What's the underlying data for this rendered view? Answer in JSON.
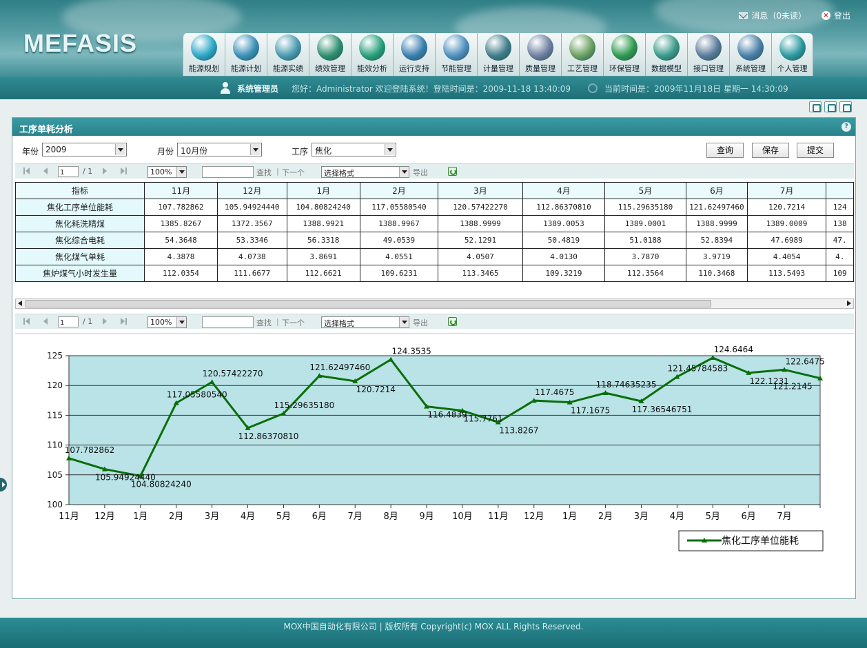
{
  "app": {
    "logo": "MEFASIS"
  },
  "top_links": {
    "messages": "消息（0未读）",
    "logout": "登出"
  },
  "nav": [
    {
      "label": "能源规划",
      "icon": "energy-planning-icon",
      "color": "#2aa6c8"
    },
    {
      "label": "能源计划",
      "icon": "energy-plan-icon",
      "color": "#3b8fb8"
    },
    {
      "label": "能源实绩",
      "icon": "energy-actual-icon",
      "color": "#4a9ab0"
    },
    {
      "label": "绩效管理",
      "icon": "performance-icon",
      "color": "#2e8f6e"
    },
    {
      "label": "能效分析",
      "icon": "efficiency-analysis-icon",
      "color": "#27a07a"
    },
    {
      "label": "运行支持",
      "icon": "operation-support-icon",
      "color": "#3a7fb0"
    },
    {
      "label": "节能管理",
      "icon": "energy-saving-icon",
      "color": "#4f8fc0"
    },
    {
      "label": "计量管理",
      "icon": "metering-icon",
      "color": "#3f7d8a"
    },
    {
      "label": "质量管理",
      "icon": "quality-icon",
      "color": "#6f7fa0"
    },
    {
      "label": "工艺管理",
      "icon": "process-icon",
      "color": "#6aa060"
    },
    {
      "label": "环保管理",
      "icon": "environment-icon",
      "color": "#2e9a4e"
    },
    {
      "label": "数据模型",
      "icon": "data-model-icon",
      "color": "#3a9a8a"
    },
    {
      "label": "接口管理",
      "icon": "interface-icon",
      "color": "#5a7a9a"
    },
    {
      "label": "系统管理",
      "icon": "system-icon",
      "color": "#4a7fa8"
    },
    {
      "label": "个人管理",
      "icon": "personal-icon",
      "color": "#2a9aa0"
    }
  ],
  "info_bar": {
    "role": "系统管理员",
    "welcome": "您好：Administrator 欢迎登陆系统！登陆时间是：2009-11-18 13:40:09",
    "now": "当前时间是：2009年11月18日 星期一 14:30:09"
  },
  "panel": {
    "title": "工序单耗分析"
  },
  "filters": {
    "year_label": "年份",
    "year_value": "2009",
    "month_label": "月份",
    "month_value": "10月份",
    "process_label": "工序",
    "process_value": "焦化",
    "query": "查询",
    "save": "保存",
    "submit": "提交"
  },
  "toolbar": {
    "page_value": "1",
    "page_total": "/ 1",
    "zoom": "100%",
    "find": "查找",
    "separator": "|",
    "next": "下一个",
    "format": "选择格式",
    "export": "导出"
  },
  "table": {
    "header_label": "指标",
    "columns": [
      "11月",
      "12月",
      "1月",
      "2月",
      "3月",
      "4月",
      "5月",
      "6月",
      "7月",
      ""
    ],
    "rows": [
      {
        "label": "焦化工序单位能耗",
        "values": [
          "107.782862",
          "105.94924440",
          "104.80824240",
          "117.05580540",
          "120.57422270",
          "112.86370810",
          "115.29635180",
          "121.62497460",
          "120.7214",
          "124"
        ]
      },
      {
        "label": "焦化耗洗精煤",
        "values": [
          "1385.8267",
          "1372.3567",
          "1388.9921",
          "1388.9967",
          "1388.9999",
          "1389.0053",
          "1389.0001",
          "1388.9999",
          "1389.0009",
          "138"
        ]
      },
      {
        "label": "焦化综合电耗",
        "values": [
          "54.3648",
          "53.3346",
          "56.3318",
          "49.0539",
          "52.1291",
          "50.4819",
          "51.0188",
          "52.8394",
          "47.6989",
          "47."
        ]
      },
      {
        "label": "焦化煤气单耗",
        "values": [
          "4.3878",
          "4.0738",
          "3.8691",
          "4.0551",
          "4.0507",
          "4.0130",
          "3.7870",
          "3.9719",
          "4.4054",
          "4."
        ]
      },
      {
        "label": "焦炉煤气小时发生量",
        "values": [
          "112.0354",
          "111.6677",
          "112.6621",
          "109.6231",
          "113.3465",
          "109.3219",
          "112.3564",
          "110.3468",
          "113.5493",
          "109"
        ]
      }
    ]
  },
  "chart_data": {
    "type": "line",
    "categories": [
      "11月",
      "12月",
      "1月",
      "2月",
      "3月",
      "4月",
      "5月",
      "6月",
      "7月",
      "8月",
      "9月",
      "10月",
      "11月",
      "12月",
      "1月",
      "2月",
      "3月",
      "4月",
      "5月",
      "6月",
      "7月"
    ],
    "series": [
      {
        "name": "焦化工序单位能耗",
        "color": "#0a6e0a",
        "values": [
          107.782862,
          105.9492444,
          104.8082424,
          117.0558054,
          120.5742227,
          112.8637081,
          115.2963518,
          121.6249746,
          120.7214,
          124.3535,
          116.4839,
          115.7761,
          113.8267,
          117.4675,
          117.1675,
          118.74635235,
          117.36546751,
          121.45784583,
          124.6464,
          122.1231,
          122.6475,
          121.2145
        ],
        "labels": [
          "107.782862",
          "105.94924440",
          "104.80824240",
          "117.05580540",
          "120.57422270",
          "112.86370810",
          "115.29635180",
          "121.62497460",
          "120.7214",
          "124.3535",
          "116.4839",
          "115.7761",
          "113.8267",
          "117.4675",
          "117.1675",
          "118.74635235",
          "117.36546751",
          "121.45784583",
          "124.6464",
          "122.1231",
          "122.6475",
          "121.2145"
        ]
      }
    ],
    "y_ticks": [
      100,
      105,
      110,
      115,
      120,
      125
    ],
    "ylim": [
      100,
      125
    ],
    "plot_bg": "#b9e3e6",
    "grid": true,
    "legend_position": "bottom-right"
  },
  "footer": {
    "text": "MOX中国自动化有限公司 | 版权所有 Copyright(c) MOX ALL Rights Reserved."
  }
}
